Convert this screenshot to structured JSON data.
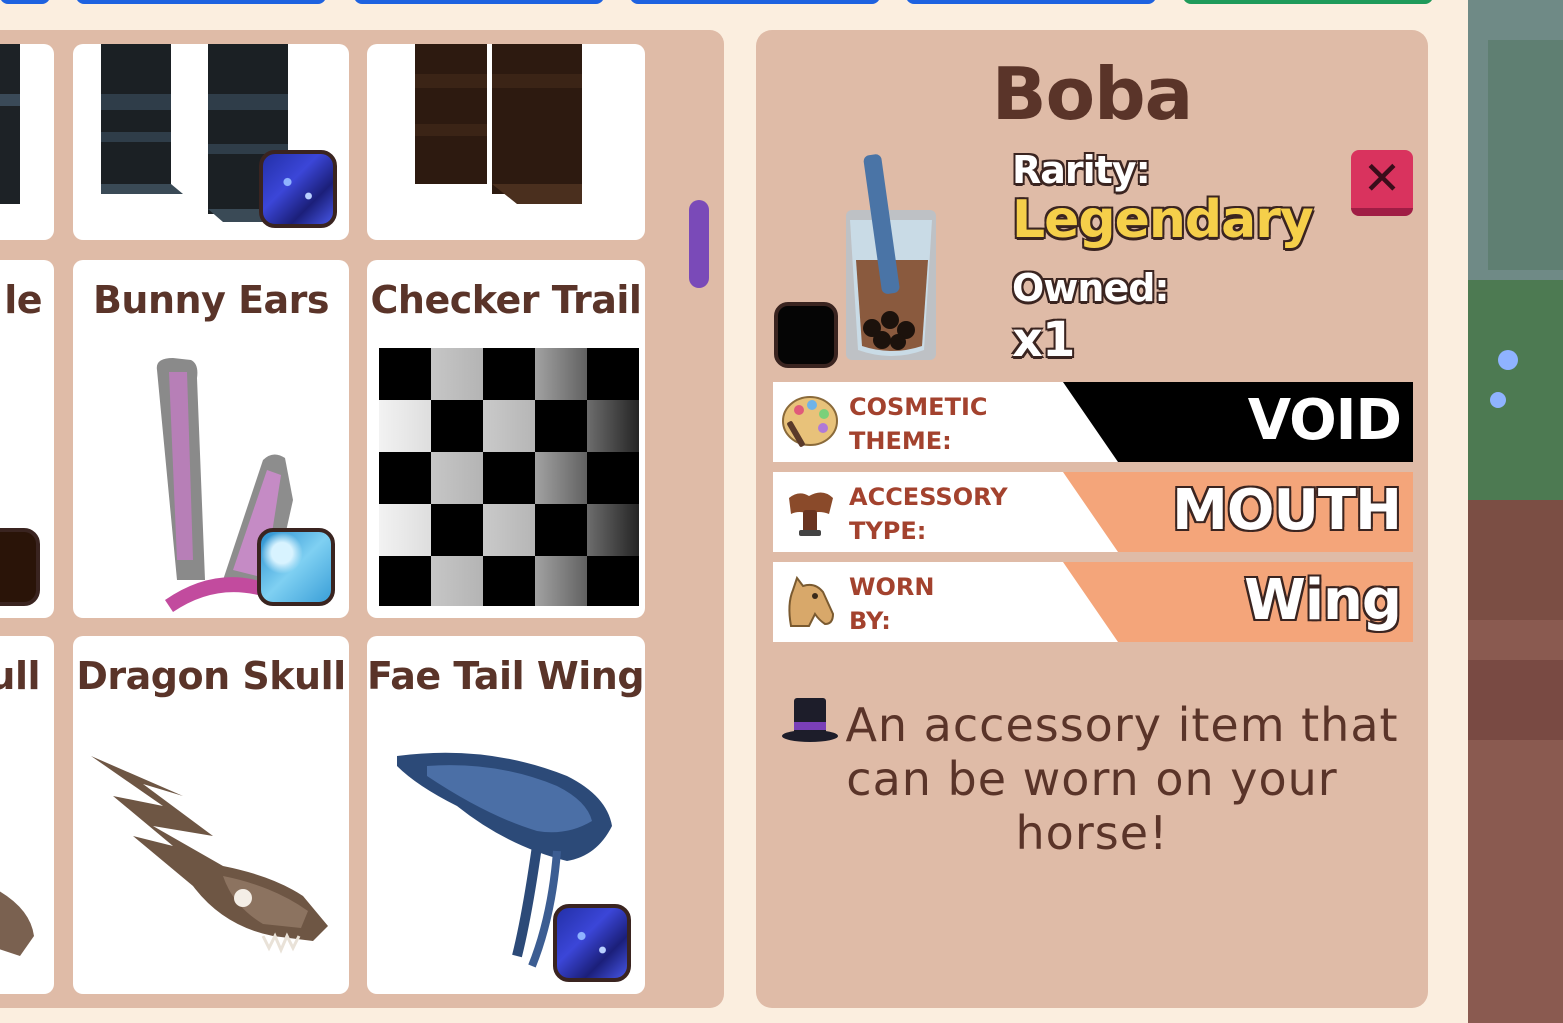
{
  "inventory": {
    "cards": [
      {
        "title": "",
        "badge": "void-theme"
      },
      {
        "title": "",
        "badge": "none"
      },
      {
        "title": "le",
        "badge": "dark-theme"
      },
      {
        "title": "Bunny Ears",
        "badge": "ice-theme"
      },
      {
        "title": "Checker Trail",
        "badge": "none"
      },
      {
        "title": "ull",
        "badge": "none"
      },
      {
        "title": "Dragon Skull",
        "badge": "none"
      },
      {
        "title": "Fae Tail Wings",
        "badge": "void-theme"
      }
    ]
  },
  "detail": {
    "name": "Boba",
    "rarity_label": "Rarity:",
    "rarity_value": "Legendary",
    "owned_label": "Owned:",
    "owned_value": "x1",
    "close_label": "✕",
    "rows": [
      {
        "label_line1": "COSMETIC",
        "label_line2": "THEME:",
        "value": "VOID",
        "icon": "palette-icon"
      },
      {
        "label_line1": "ACCESSORY",
        "label_line2": "TYPE:",
        "value": "MOUTH",
        "icon": "saddle-icon"
      },
      {
        "label_line1": "WORN",
        "label_line2": "BY:",
        "value": "Wing",
        "icon": "horse-head-icon"
      }
    ],
    "description": "An accessory item that can be worn on your horse!",
    "description_icon": "top-hat-icon"
  },
  "colors": {
    "panel": "#dfbba7",
    "title_text": "#5a3429",
    "legendary": "#f5cf4a",
    "void_band": "#000000",
    "orange_band": "#f4a57a",
    "close_button": "#d9335e"
  }
}
